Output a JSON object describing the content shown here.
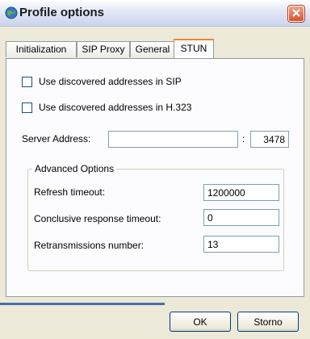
{
  "window": {
    "title": "Profile options"
  },
  "tabs": [
    {
      "label": "Initialization"
    },
    {
      "label": "SIP Proxy"
    },
    {
      "label": "General"
    },
    {
      "label": "STUN"
    }
  ],
  "active_tab": "STUN",
  "stun": {
    "use_sip_label": "Use discovered addresses in SIP",
    "use_sip_checked": false,
    "use_h323_label": "Use discovered addresses in H.323",
    "use_h323_checked": false,
    "server_address_label": "Server Address:",
    "server_address_value": "",
    "port_separator": ":",
    "port_value": "3478",
    "advanced": {
      "title": "Advanced Options",
      "refresh_label": "Refresh timeout:",
      "refresh_value": "1200000",
      "conclusive_label": "Conclusive response timeout:",
      "conclusive_value": "0",
      "retrans_label": "Retransmissions number:",
      "retrans_value": "13"
    }
  },
  "buttons": {
    "ok": "OK",
    "cancel": "Storno"
  },
  "colors": {
    "dialog_bg": "#ece9d8",
    "active_tab_accent": "#e68b2c",
    "close_button": "#d4532f"
  }
}
